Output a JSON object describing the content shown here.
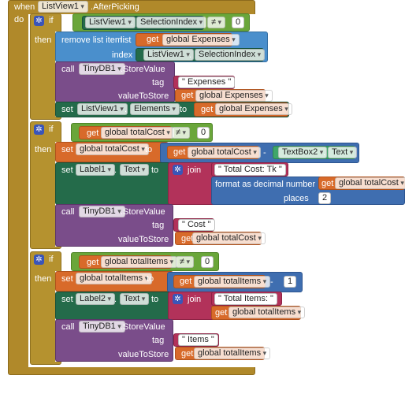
{
  "colors": {
    "event": "#b0892a",
    "control": "#b5922f",
    "list": "#4a8fcc",
    "tinydb": "#7a4d8a",
    "component": "#246b4a",
    "variable": "#d86a2a",
    "logic": "#6aa63a",
    "text": "#b2325a",
    "math": "#3f6eb0"
  },
  "event": {
    "when": "when",
    "component": "ListView1",
    "event": ".AfterPicking",
    "do": "do"
  },
  "kw": {
    "if": "if",
    "then": "then",
    "set": "set",
    "to": "to",
    "call": "call",
    "get": "get",
    "join": "join",
    "remove": "remove list item",
    "list": "list",
    "index": "index",
    "tag": "tag",
    "value": "valueToStore",
    "store": ".StoreValue",
    "format": "format as decimal number",
    "number": "number",
    "places": "places",
    "dot": "."
  },
  "if1": {
    "cond": {
      "comp": "ListView1",
      "prop": "SelectionIndex",
      "op": "≠",
      "num": "0"
    },
    "remove": {
      "var": "global Expenses",
      "idx_comp": "ListView1",
      "idx_prop": "SelectionIndex"
    },
    "store": {
      "db": "TinyDB1",
      "tag": "\" Expenses \"",
      "var": "global Expenses"
    },
    "set": {
      "comp": "ListView1",
      "prop": "Elements",
      "var": "global Expenses"
    }
  },
  "if2": {
    "cond": {
      "var": "global totalCost",
      "op": "≠",
      "num": "0"
    },
    "set1": {
      "var": "global totalCost",
      "get": "global totalCost",
      "op": "-",
      "tb": "TextBox2",
      "tbprop": "Text"
    },
    "set2": {
      "comp": "Label1",
      "prop": "Text",
      "str": "\" Total Cost: Tk \"",
      "var": "global totalCost",
      "places": "2"
    },
    "store": {
      "db": "TinyDB1",
      "tag": "\" Cost \"",
      "var": "global totalCost"
    }
  },
  "if3": {
    "cond": {
      "var": "global totalItems",
      "op": "≠",
      "num": "0"
    },
    "set1": {
      "var": "global totalItems",
      "get": "global totalItems",
      "op": "-",
      "num": "1"
    },
    "set2": {
      "comp": "Label2",
      "prop": "Text",
      "str": "\" Total Items: \"",
      "var": "global totalItems"
    },
    "store": {
      "db": "TinyDB1",
      "tag": "\" Items \"",
      "var": "global totalItems"
    }
  }
}
